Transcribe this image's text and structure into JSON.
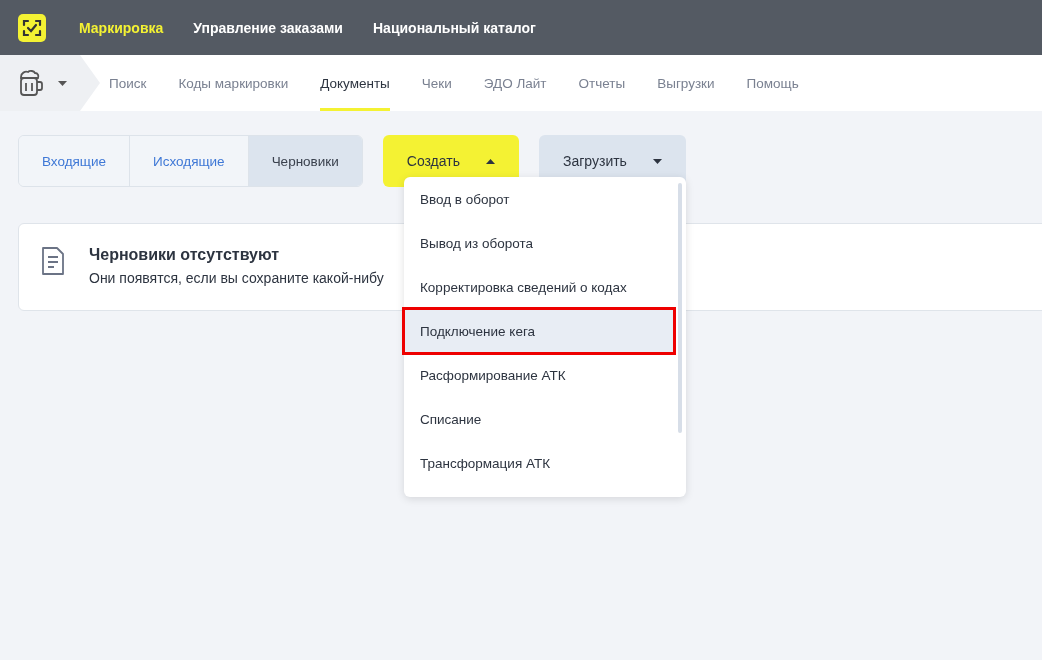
{
  "top_nav": [
    {
      "label": "Маркировка",
      "selected": true
    },
    {
      "label": "Управление заказами",
      "selected": false
    },
    {
      "label": "Национальный каталог",
      "selected": false
    }
  ],
  "sub_nav": [
    {
      "label": "Поиск",
      "selected": false
    },
    {
      "label": "Коды маркировки",
      "selected": false
    },
    {
      "label": "Документы",
      "selected": true
    },
    {
      "label": "Чеки",
      "selected": false
    },
    {
      "label": "ЭДО Лайт",
      "selected": false
    },
    {
      "label": "Отчеты",
      "selected": false
    },
    {
      "label": "Выгрузки",
      "selected": false
    },
    {
      "label": "Помощь",
      "selected": false
    }
  ],
  "doc_tabs": [
    {
      "label": "Входящие",
      "selected": false
    },
    {
      "label": "Исходящие",
      "selected": false
    },
    {
      "label": "Черновики",
      "selected": true
    }
  ],
  "create_button": {
    "label": "Создать",
    "expanded": true
  },
  "upload_button": {
    "label": "Загрузить",
    "expanded": false
  },
  "empty_state": {
    "title": "Черновики отсутствуют",
    "text": "Они появятся, если вы сохраните какой-нибу"
  },
  "create_menu": [
    {
      "label": "Ввод в оборот",
      "selected": false,
      "annotated": false
    },
    {
      "label": "Вывод из оборота",
      "selected": false,
      "annotated": false
    },
    {
      "label": "Корректировка сведений о кодах",
      "selected": false,
      "annotated": false
    },
    {
      "label": "Подключение кега",
      "selected": true,
      "annotated": true
    },
    {
      "label": "Расформирование АТК",
      "selected": false,
      "annotated": false
    },
    {
      "label": "Списание",
      "selected": false,
      "annotated": false
    },
    {
      "label": "Трансформация АТК",
      "selected": false,
      "annotated": false
    }
  ]
}
